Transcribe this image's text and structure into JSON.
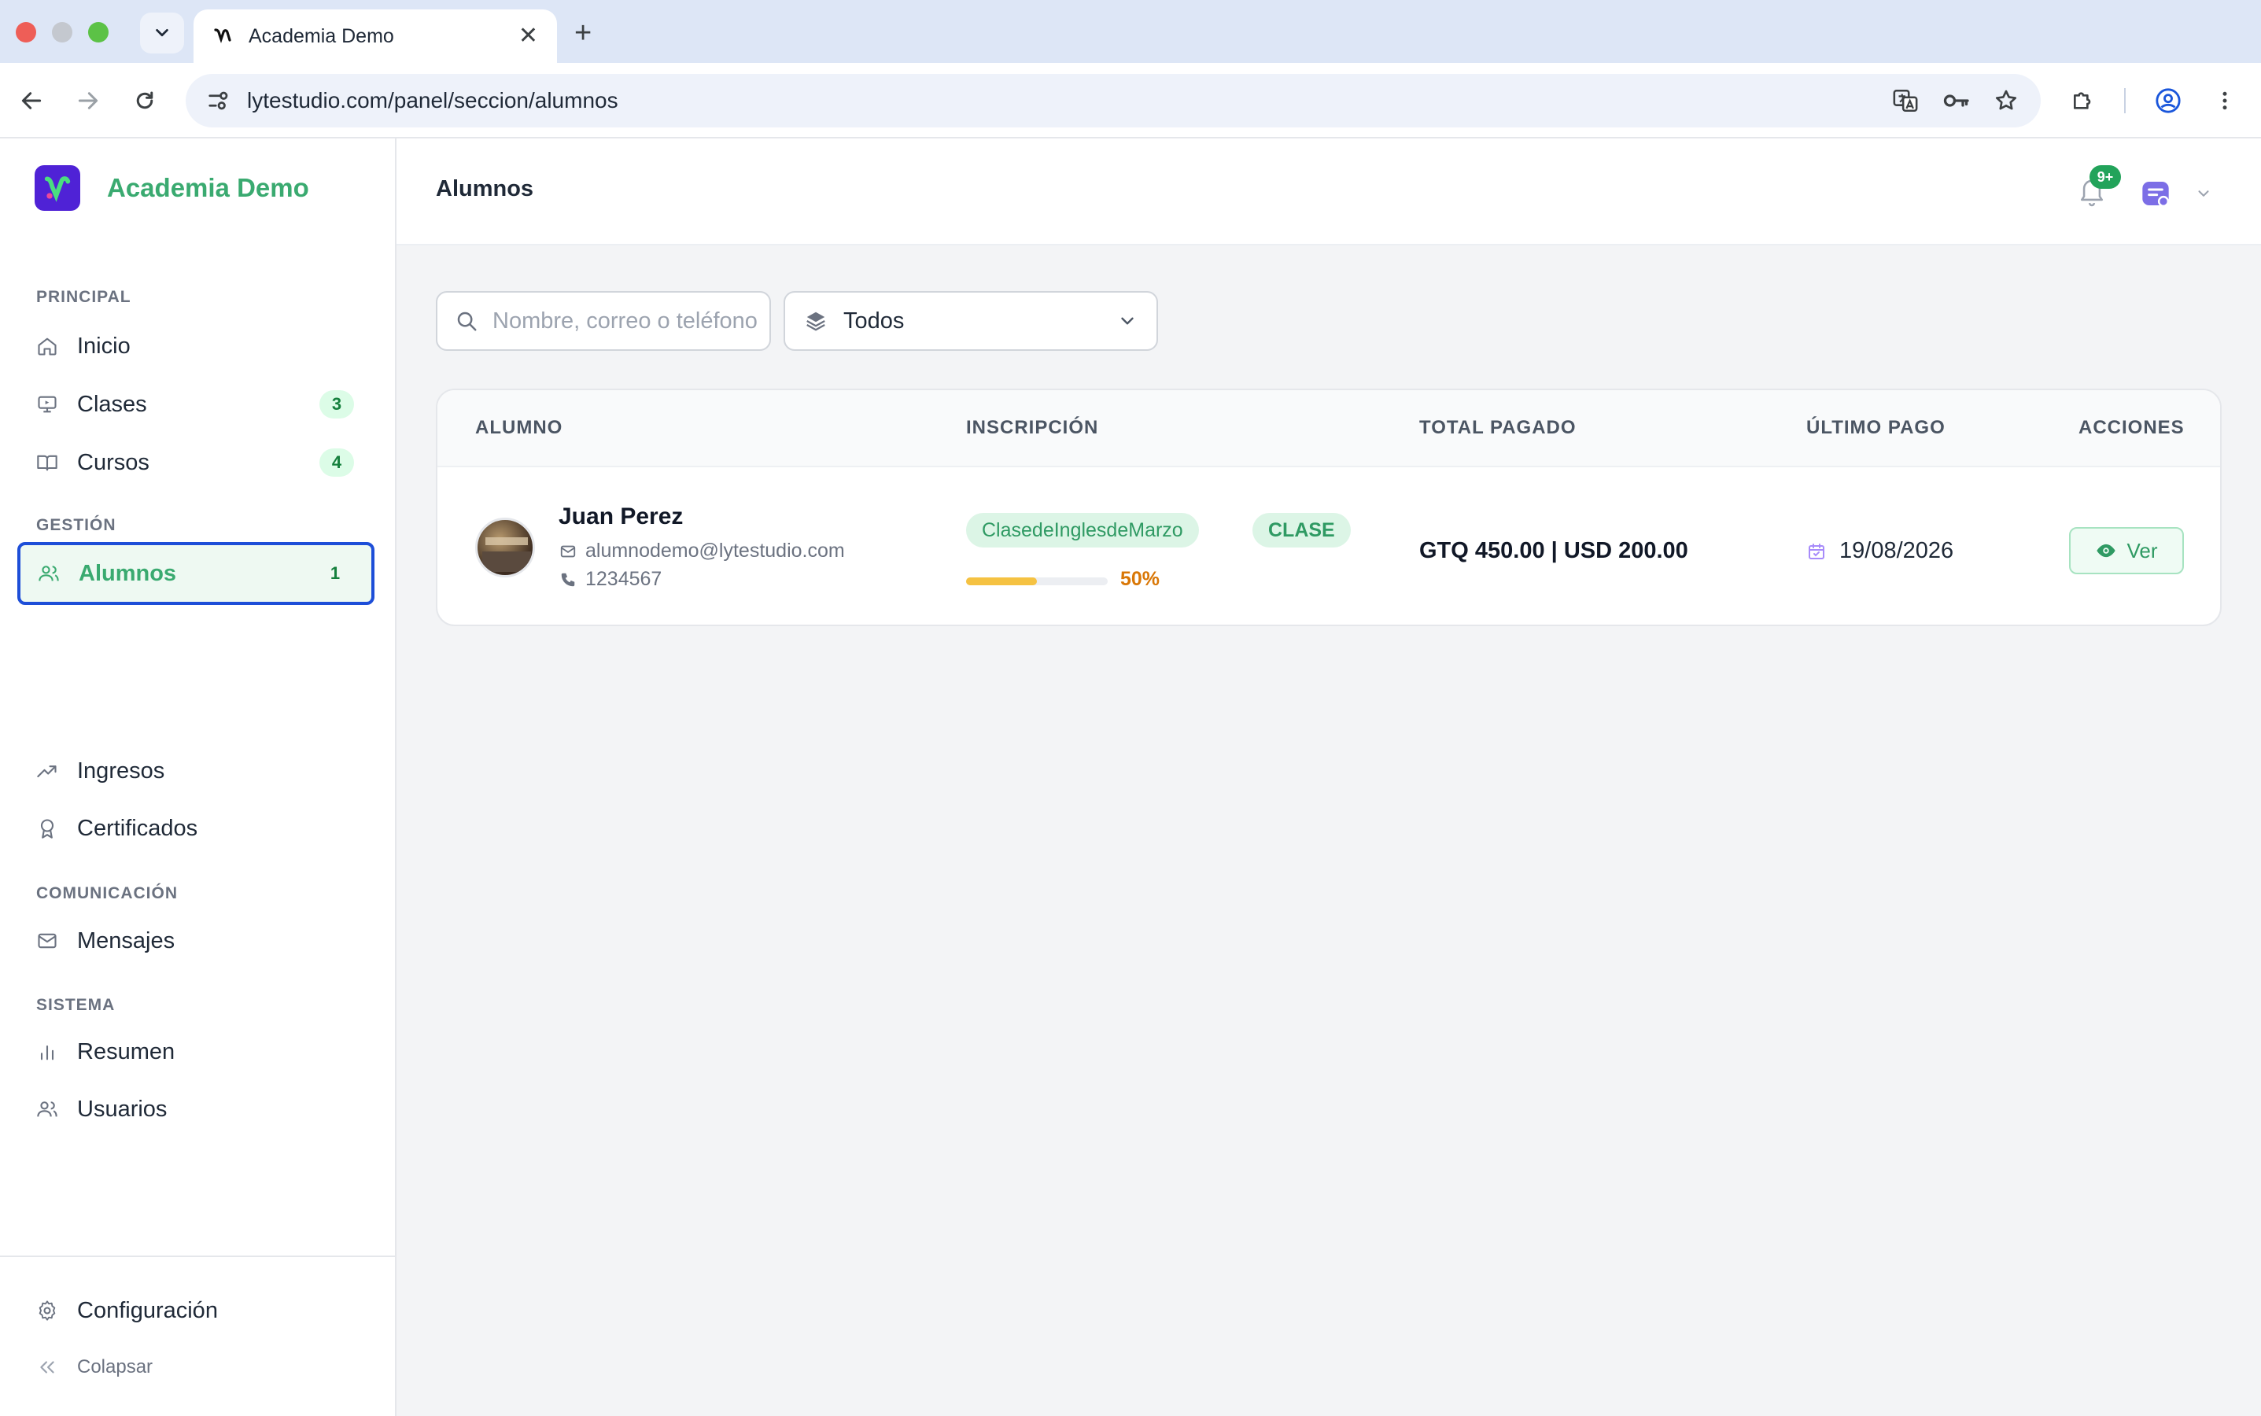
{
  "browser": {
    "tab_title": "Academia Demo",
    "url": "lytestudio.com/panel/seccion/alumnos",
    "new_tab": "+",
    "close_tab": "✕"
  },
  "brand": {
    "name": "Academia Demo",
    "accent": "#3aaa70",
    "logo_bg": "#4f22d6"
  },
  "sidebar": {
    "sections": [
      "PRINCIPAL",
      "GESTIÓN",
      "COMUNICACIÓN",
      "SISTEMA"
    ],
    "items": [
      {
        "label": "Inicio",
        "icon": "home-icon"
      },
      {
        "label": "Clases",
        "icon": "monitor-play-icon",
        "badge": "3"
      },
      {
        "label": "Cursos",
        "icon": "book-open-icon",
        "badge": "4"
      },
      {
        "label": "Alumnos",
        "icon": "users-icon",
        "badge": "1",
        "active": true
      },
      {
        "label": "Ingresos",
        "icon": "trending-up-icon"
      },
      {
        "label": "Certificados",
        "icon": "award-icon"
      },
      {
        "label": "Mensajes",
        "icon": "mail-icon"
      },
      {
        "label": "Resumen",
        "icon": "bar-chart-icon"
      },
      {
        "label": "Usuarios",
        "icon": "user-group-icon"
      }
    ],
    "settings_label": "Configuración",
    "collapse_label": "Colapsar"
  },
  "header": {
    "title": "Alumnos",
    "notifications_badge": "9+"
  },
  "filters": {
    "search_placeholder": "Nombre, correo o teléfono",
    "select_value": "Todos"
  },
  "table": {
    "columns": [
      "ALUMNO",
      "INSCRIPCIÓN",
      "TOTAL PAGADO",
      "ÚLTIMO PAGO",
      "ACCIONES"
    ],
    "rows": [
      {
        "name": "Juan Perez",
        "email": "alumnodemo@lytestudio.com",
        "phone": "1234567",
        "enrollment": "ClasedeInglesdeMarzo",
        "type": "CLASE",
        "progress": 0.5,
        "progress_label": "50%",
        "total": "GTQ 450.00 | USD 200.00",
        "last_payment": "19/08/2026",
        "action": "Ver"
      }
    ]
  }
}
